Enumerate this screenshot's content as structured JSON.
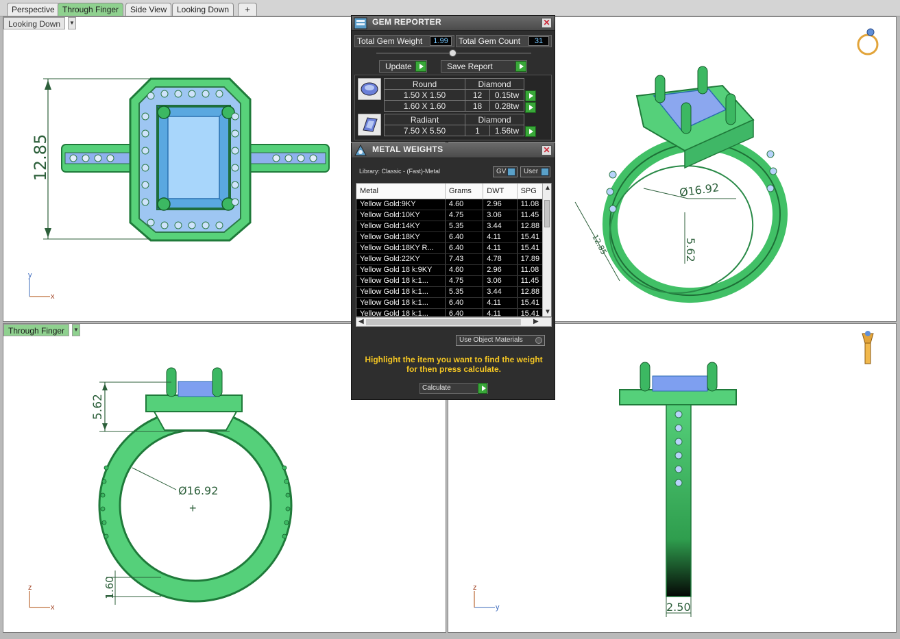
{
  "tabs": [
    {
      "label": "Perspective",
      "active": false
    },
    {
      "label": "Through Finger",
      "active": true
    },
    {
      "label": "Side View",
      "active": false
    },
    {
      "label": "Looking Down",
      "active": false
    }
  ],
  "add_tab_glyph": "+",
  "viewports": {
    "top_left": {
      "label": "Looking Down",
      "dim_height": "12.85",
      "axis_v": "y",
      "axis_h": "x"
    },
    "top_right": {
      "dim_diameter": "Ø16.92",
      "dim_height": "5.62",
      "dim_side": "12.85"
    },
    "bottom_left": {
      "label": "Through Finger",
      "dim_top": "5.62",
      "dim_diameter": "Ø16.92",
      "dim_bottom": "1.60",
      "axis_v": "z",
      "axis_h": "x"
    },
    "bottom_right": {
      "dim_width": "2.50",
      "axis_v": "z",
      "axis_h": "y"
    }
  },
  "gem_reporter": {
    "title": "GEM REPORTER",
    "total_weight_label": "Total Gem Weight",
    "total_weight_value": "1.99",
    "total_count_label": "Total Gem Count",
    "total_count_value": "31",
    "update_label": "Update",
    "save_label": "Save Report",
    "groups": [
      {
        "shape": "Round",
        "material": "Diamond",
        "rows": [
          {
            "size": "1.50 X 1.50",
            "count": "12",
            "weight": "0.15tw"
          },
          {
            "size": "1.60 X 1.60",
            "count": "18",
            "weight": "0.28tw"
          }
        ]
      },
      {
        "shape": "Radiant",
        "material": "Diamond",
        "rows": [
          {
            "size": "7.50 X 5.50",
            "count": "1",
            "weight": "1.56tw"
          }
        ]
      }
    ]
  },
  "metal_weights": {
    "title": "METAL WEIGHTS",
    "library": "Library: Classic - (Fast)-Metal",
    "gv_label": "GV",
    "user_label": "User",
    "columns": [
      "Metal",
      "Grams",
      "DWT",
      "SPG"
    ],
    "rows": [
      [
        "Yellow Gold:9KY",
        "4.60",
        "2.96",
        "11.08"
      ],
      [
        "Yellow Gold:10KY",
        "4.75",
        "3.06",
        "11.45"
      ],
      [
        "Yellow Gold:14KY",
        "5.35",
        "3.44",
        "12.88"
      ],
      [
        "Yellow Gold:18KY",
        "6.40",
        "4.11",
        "15.41"
      ],
      [
        "Yellow Gold:18KY R...",
        "6.40",
        "4.11",
        "15.41"
      ],
      [
        "Yellow Gold:22KY",
        "7.43",
        "4.78",
        "17.89"
      ],
      [
        "Yellow Gold 18 k:9KY",
        "4.60",
        "2.96",
        "11.08"
      ],
      [
        "Yellow Gold 18 k:1...",
        "4.75",
        "3.06",
        "11.45"
      ],
      [
        "Yellow Gold 18 k:1...",
        "5.35",
        "3.44",
        "12.88"
      ],
      [
        "Yellow Gold 18 k:1...",
        "6.40",
        "4.11",
        "15.41"
      ],
      [
        "Yellow Gold 18 k:1...",
        "6.40",
        "4.11",
        "15.41"
      ]
    ],
    "use_materials_label": "Use Object Materials",
    "hint": "Highlight the item you want to find the weight for then press calculate.",
    "calculate_label": "Calculate"
  }
}
